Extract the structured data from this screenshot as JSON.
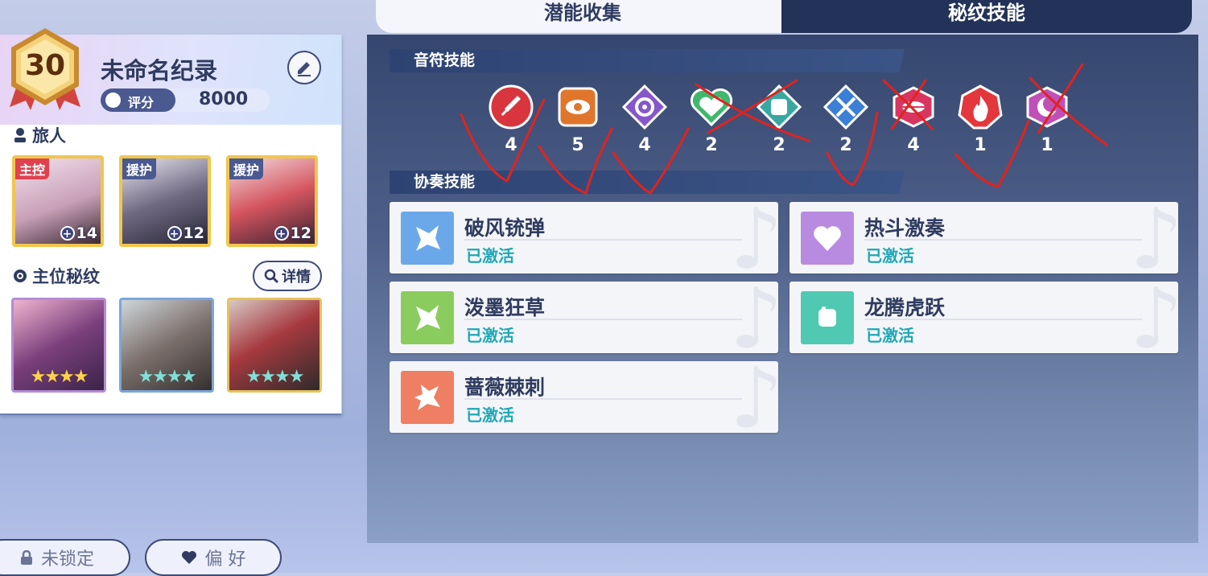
{
  "profile": {
    "level": "30",
    "name": "未命名纪录",
    "score_label": "评分",
    "score_value": "8000",
    "travelers_title": "旅人",
    "characters": [
      {
        "tag": "主控",
        "level": "14",
        "tag_color": "#e0414f"
      },
      {
        "tag": "援护",
        "level": "12",
        "tag_color": "#4a5990"
      },
      {
        "tag": "援护",
        "level": "12",
        "tag_color": "#4a5990"
      }
    ],
    "rune_section_title": "主位秘纹",
    "detail_label": "详情",
    "rune_cards": [
      {
        "stars": "★★★★",
        "border": "#b48bd6"
      },
      {
        "stars": "★★★★",
        "border": "#7ba6db"
      },
      {
        "stars": "★★★★",
        "border": "#e6c35b"
      }
    ]
  },
  "bottom": {
    "lock_label": "未锁定",
    "favorite_label": "偏 好"
  },
  "tabs": {
    "left": "潜能收集",
    "right": "秘纹技能"
  },
  "note_skills": {
    "title": "音符技能",
    "runes": [
      {
        "icon": "sword-icon",
        "count": "4",
        "color": "#d9353f"
      },
      {
        "icon": "eye-icon",
        "count": "5",
        "color": "#e0762c"
      },
      {
        "icon": "vortex-icon",
        "count": "4",
        "color": "#8657c9"
      },
      {
        "icon": "heart-icon",
        "count": "2",
        "color": "#3fb86e"
      },
      {
        "icon": "fist-icon",
        "count": "2",
        "color": "#39a8a3"
      },
      {
        "icon": "crossed-swords-icon",
        "count": "2",
        "color": "#3c7fd6"
      },
      {
        "icon": "lips-icon",
        "count": "4",
        "color": "#d8365f"
      },
      {
        "icon": "flame-icon",
        "count": "1",
        "color": "#e3373c"
      },
      {
        "icon": "moon-icon",
        "count": "1",
        "color": "#c050b8"
      }
    ]
  },
  "ensemble_skills": {
    "title": "协奏技能",
    "items": [
      {
        "name": "破风铳弹",
        "state": "已激活",
        "color": "#6aa8ea"
      },
      {
        "name": "热斗激奏",
        "state": "已激活",
        "color": "#b88be0"
      },
      {
        "name": "泼墨狂草",
        "state": "已激活",
        "color": "#8bcc5e"
      },
      {
        "name": "龙腾虎跃",
        "state": "已激活",
        "color": "#4fc9b1"
      },
      {
        "name": "蔷薇棘刺",
        "state": "已激活",
        "color": "#ee7f63"
      }
    ]
  },
  "colors": {
    "check_mark": "#e0231e",
    "panel_dark": "#223258"
  }
}
